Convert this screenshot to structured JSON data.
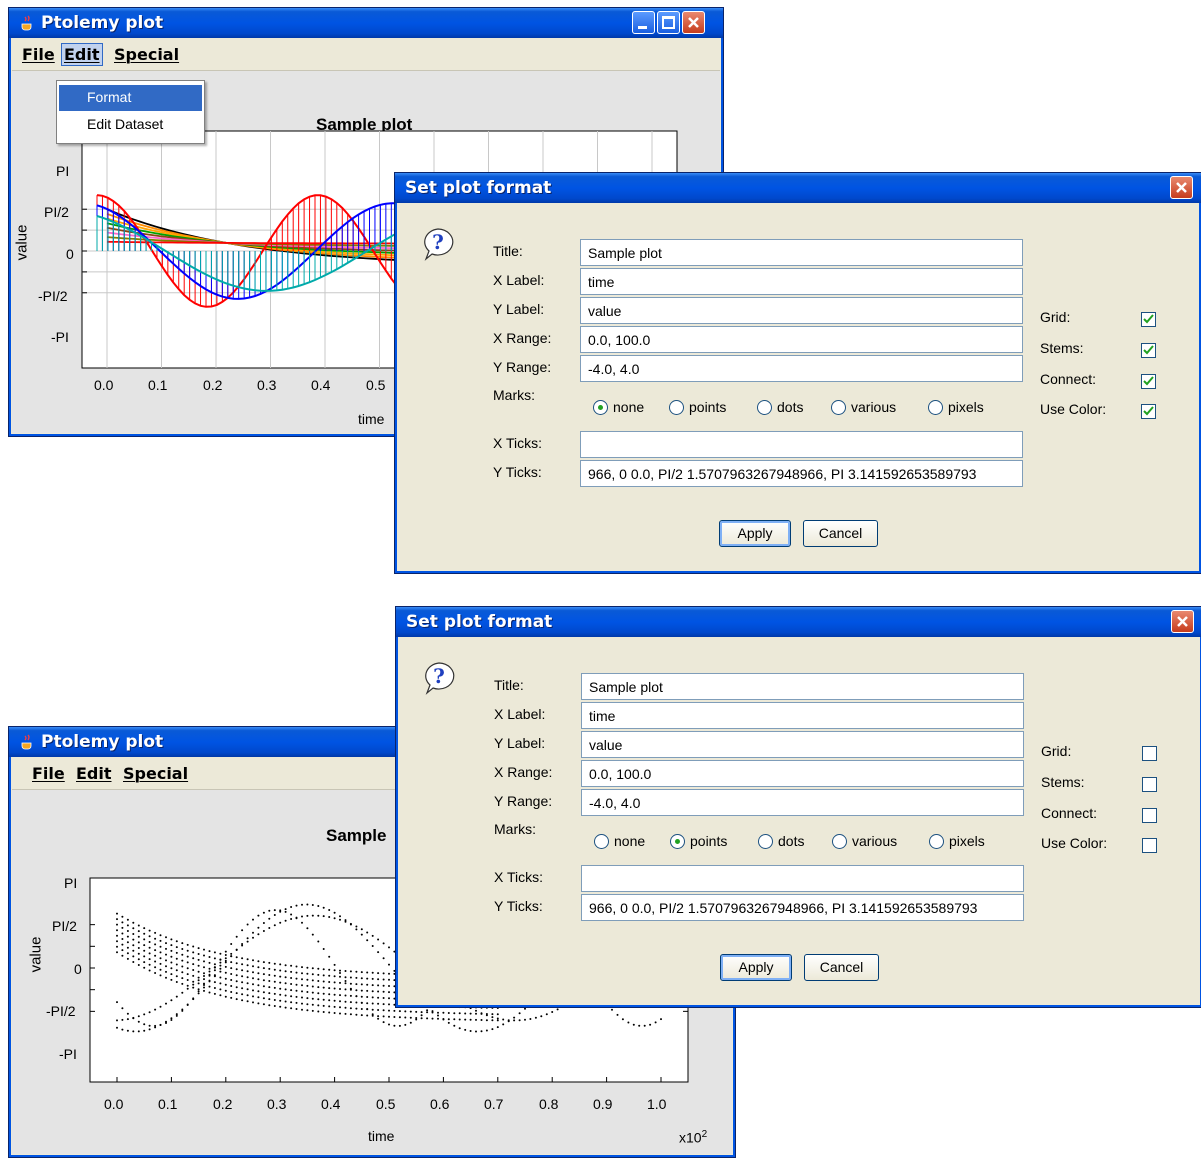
{
  "plot_window_top": {
    "title": "Ptolemy plot",
    "menus": [
      "File",
      "Edit",
      "Special"
    ],
    "active_menu": "Edit",
    "edit_menu_items": [
      "Format",
      "Edit Dataset"
    ],
    "selected_item": "Format",
    "plot_title": "Sample plot",
    "ylabel": "value",
    "xlabel": "time",
    "y_ticks": [
      "PI",
      "PI/2",
      "0",
      "-PI/2",
      "-PI"
    ],
    "x_ticks": [
      "0.0",
      "0.1",
      "0.2",
      "0.3",
      "0.4",
      "0.5"
    ]
  },
  "plot_window_bottom": {
    "title": "Ptolemy plot",
    "menus": [
      "File",
      "Edit",
      "Special"
    ],
    "plot_title": "Sample",
    "ylabel": "value",
    "xlabel": "time",
    "exponent_label": "x10",
    "exponent_power": "2",
    "y_ticks": [
      "PI",
      "PI/2",
      "0",
      "-PI/2",
      "-PI"
    ],
    "x_ticks": [
      "0.0",
      "0.1",
      "0.2",
      "0.3",
      "0.4",
      "0.5",
      "0.6",
      "0.7",
      "0.8",
      "0.9",
      "1.0"
    ]
  },
  "dialog_top": {
    "title": "Set plot format",
    "labels": {
      "title": "Title:",
      "xlabel": "X Label:",
      "ylabel": "Y Label:",
      "xrange": "X Range:",
      "yrange": "Y Range:",
      "marks": "Marks:",
      "xticks": "X Ticks:",
      "yticks": "Y Ticks:"
    },
    "values": {
      "title": "Sample plot",
      "xlabel": "time",
      "ylabel": "value",
      "xrange": "0.0, 100.0",
      "yrange": "-4.0, 4.0",
      "xticks": "",
      "yticks": "966, 0 0.0, PI/2 1.5707963267948966, PI 3.141592653589793"
    },
    "marks_options": [
      "none",
      "points",
      "dots",
      "various",
      "pixels"
    ],
    "marks_selected": "none",
    "checkbox_labels": [
      "Grid:",
      "Stems:",
      "Connect:",
      "Use Color:"
    ],
    "checkbox_checked": [
      true,
      true,
      true,
      true
    ],
    "apply_label": "Apply",
    "cancel_label": "Cancel"
  },
  "dialog_bottom": {
    "title": "Set plot format",
    "labels": {
      "title": "Title:",
      "xlabel": "X Label:",
      "ylabel": "Y Label:",
      "xrange": "X Range:",
      "yrange": "Y Range:",
      "marks": "Marks:",
      "xticks": "X Ticks:",
      "yticks": "Y Ticks:"
    },
    "values": {
      "title": "Sample plot",
      "xlabel": "time",
      "ylabel": "value",
      "xrange": "0.0, 100.0",
      "yrange": "-4.0, 4.0",
      "xticks": "",
      "yticks": "966, 0 0.0, PI/2 1.5707963267948966, PI 3.141592653589793"
    },
    "marks_options": [
      "none",
      "points",
      "dots",
      "various",
      "pixels"
    ],
    "marks_selected": "points",
    "checkbox_labels": [
      "Grid:",
      "Stems:",
      "Connect:",
      "Use Color:"
    ],
    "checkbox_checked": [
      false,
      false,
      false,
      false
    ],
    "apply_label": "Apply",
    "cancel_label": "Cancel"
  },
  "colors": {
    "xp_titlebar": "#0054e3",
    "dialog_bg": "#ece9d8",
    "check_mark": "#21a121",
    "series": [
      "#ff0000",
      "#0000ff",
      "#00aaaa",
      "#000000",
      "#ff8c00",
      "#ffa500",
      "#00a000",
      "#8b4513",
      "#ff66cc",
      "#808000"
    ]
  },
  "icons": {
    "app": "java-cup-icon",
    "help": "question-icon",
    "minimize": "minimize-icon",
    "maximize": "maximize-icon",
    "close": "close-icon",
    "check": "check-icon"
  }
}
